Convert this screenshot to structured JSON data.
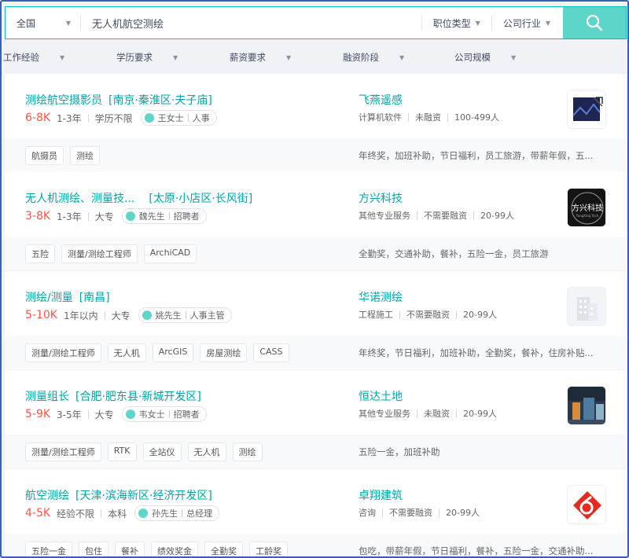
{
  "search": {
    "city": "全国",
    "query": "无人机航空测绘",
    "position_type": "职位类型",
    "industry": "公司行业"
  },
  "filters": [
    "工作经验",
    "学历要求",
    "薪资要求",
    "融资阶段",
    "公司规模"
  ],
  "jobs": [
    {
      "title": "测绘航空摄影员",
      "area": "[南京·秦淮区·夫子庙]",
      "salary": "6-8K",
      "experience": "1-3年",
      "education": "学历不限",
      "recruiter_name": "王女士",
      "recruiter_title": "人事",
      "company": "飞燕遥感",
      "company_info": [
        "计算机软件",
        "未融资",
        "100-499人"
      ],
      "tags": [
        "航摄员",
        "测绘"
      ],
      "welfare": "年终奖，加班补助，节日福利，员工旅游，带薪年假，五..."
    },
    {
      "title": "无人机测绘、测量技...",
      "area": "[太原·小店区·长风街]",
      "salary": "3-8K",
      "experience": "1-3年",
      "education": "大专",
      "recruiter_name": "魏先生",
      "recruiter_title": "招聘者",
      "company": "方兴科技",
      "company_info": [
        "其他专业服务",
        "不需要融资",
        "20-99人"
      ],
      "tags": [
        "五险",
        "测量/测绘工程师",
        "ArchiCAD"
      ],
      "welfare": "全勤奖，交通补助，餐补，五险一金，员工旅游"
    },
    {
      "title": "测绘/测量",
      "area": "[南昌]",
      "salary": "5-10K",
      "experience": "1年以内",
      "education": "大专",
      "recruiter_name": "姚先生",
      "recruiter_title": "人事主管",
      "company": "华诺测绘",
      "company_info": [
        "工程施工",
        "不需要融资",
        "20-99人"
      ],
      "tags": [
        "测量/测绘工程师",
        "无人机",
        "ArcGIS",
        "房屋测绘",
        "CASS"
      ],
      "welfare": "年终奖，节日福利，加班补助，全勤奖，餐补，住房补贴..."
    },
    {
      "title": "测量组长",
      "area": "[合肥·肥东县·新城开发区]",
      "salary": "5-9K",
      "experience": "3-5年",
      "education": "大专",
      "recruiter_name": "韦女士",
      "recruiter_title": "招聘者",
      "company": "恒达土地",
      "company_info": [
        "其他专业服务",
        "未融资",
        "20-99人"
      ],
      "tags": [
        "测量/测绘工程师",
        "RTK",
        "全站仪",
        "无人机",
        "测绘"
      ],
      "welfare": "五险一金，加班补助"
    },
    {
      "title": "航空测绘",
      "area": "[天津·滨海新区·经济开发区]",
      "salary": "4-5K",
      "experience": "经验不限",
      "education": "本科",
      "recruiter_name": "孙先生",
      "recruiter_title": "总经理",
      "company": "卓翔建筑",
      "company_info": [
        "咨询",
        "不需要融资",
        "20-99人"
      ],
      "tags": [
        "五险一金",
        "包住",
        "餐补",
        "绩效奖金",
        "全勤奖",
        "工龄奖"
      ],
      "welfare": "包吃，带薪年假，节日福利，餐补，五险一金，交通补助..."
    }
  ],
  "logo_text": {
    "fangxing": "方兴科技",
    "fangxing_sub": "FangXing Tech"
  }
}
